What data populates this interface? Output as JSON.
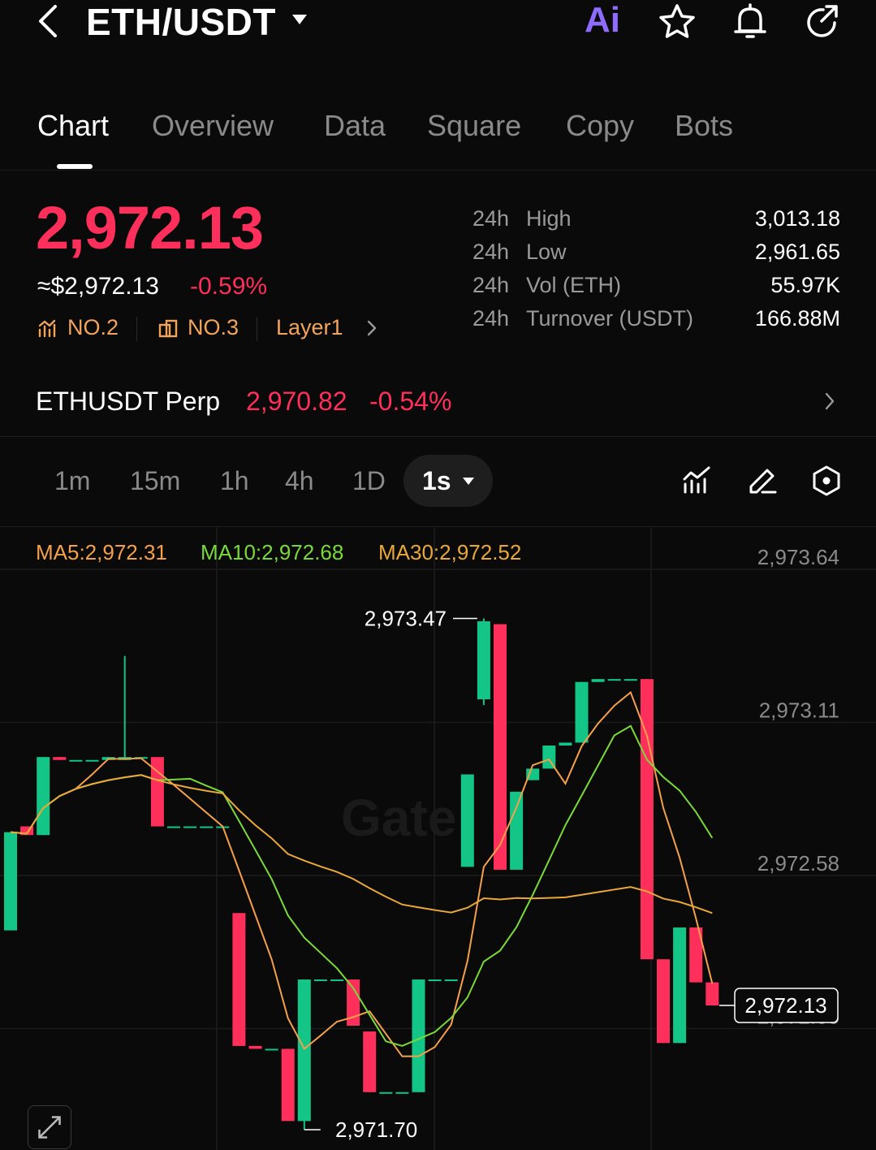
{
  "header": {
    "pair": "ETH/USDT",
    "ai_label": "Ai",
    "icons": [
      "back-icon",
      "caret-down-icon",
      "ai-icon",
      "star-icon",
      "bell-icon",
      "share-icon"
    ]
  },
  "tabs": [
    {
      "label": "Chart",
      "active": true
    },
    {
      "label": "Overview",
      "active": false
    },
    {
      "label": "Data",
      "active": false
    },
    {
      "label": "Square",
      "active": false
    },
    {
      "label": "Copy",
      "active": false
    },
    {
      "label": "Bots",
      "active": false
    }
  ],
  "ticker": {
    "price": "2,972.13",
    "approx": "≈$2,972.13",
    "change": "-0.59%",
    "rank1": "NO.2",
    "rank2": "NO.3",
    "category": "Layer1"
  },
  "stats": [
    {
      "period": "24h",
      "label": "High",
      "value": "3,013.18"
    },
    {
      "period": "24h",
      "label": "Low",
      "value": "2,961.65"
    },
    {
      "period": "24h",
      "label": "Vol (ETH)",
      "value": "55.97K"
    },
    {
      "period": "24h",
      "label": "Turnover (USDT)",
      "value": "166.88M"
    }
  ],
  "perp": {
    "name": "ETHUSDT Perp",
    "price": "2,970.82",
    "change": "-0.54%"
  },
  "intervals": [
    "1m",
    "15m",
    "1h",
    "4h",
    "1D"
  ],
  "active_interval": "1s",
  "ma": {
    "ma5": "MA5:2,972.31",
    "ma10": "MA10:2,972.68",
    "ma30": "MA30:2,972.52"
  },
  "colors": {
    "up": "#13c586",
    "down": "#ff2f5b",
    "ma5": "#f5a04a",
    "ma10": "#7ad93a",
    "ma30": "#e9a83a"
  },
  "chart_data": {
    "type": "candlestick",
    "y_ticks": [
      2973.64,
      2973.11,
      2972.58,
      2972.05
    ],
    "y_tick_labels": [
      "2,973.64",
      "2,973.11",
      "2,972.58",
      "2,972.05"
    ],
    "ylim": [
      2971.7,
      2973.64
    ],
    "high_label": "2,973.47",
    "low_label": "2,971.70",
    "current_label": "2,972.13",
    "current_price": 2972.13,
    "candles": [
      {
        "o": 2972.39,
        "c": 2972.73,
        "h": 2972.73,
        "l": 2972.39
      },
      {
        "o": 2972.75,
        "c": 2972.72,
        "h": 2972.75,
        "l": 2972.72
      },
      {
        "o": 2972.72,
        "c": 2972.99,
        "h": 2972.99,
        "l": 2972.72
      },
      {
        "o": 2972.99,
        "c": 2972.98,
        "h": 2972.99,
        "l": 2972.98
      },
      {
        "o": 2972.98,
        "c": 2972.98,
        "h": 2972.98,
        "l": 2972.98
      },
      {
        "o": 2972.98,
        "c": 2972.98,
        "h": 2972.98,
        "l": 2972.98
      },
      {
        "o": 2972.98,
        "c": 2972.99,
        "h": 2972.99,
        "l": 2972.98
      },
      {
        "o": 2972.98,
        "c": 2972.99,
        "h": 2973.34,
        "l": 2972.98
      },
      {
        "o": 2972.99,
        "c": 2972.99,
        "h": 2972.99,
        "l": 2972.99
      },
      {
        "o": 2972.99,
        "c": 2972.75,
        "h": 2972.99,
        "l": 2972.75
      },
      {
        "o": 2972.75,
        "c": 2972.75,
        "h": 2972.75,
        "l": 2972.75
      },
      {
        "o": 2972.75,
        "c": 2972.75,
        "h": 2972.75,
        "l": 2972.75
      },
      {
        "o": 2972.75,
        "c": 2972.75,
        "h": 2972.75,
        "l": 2972.75
      },
      {
        "o": 2972.75,
        "c": 2972.75,
        "h": 2972.75,
        "l": 2972.75
      },
      {
        "o": 2972.45,
        "c": 2971.99,
        "h": 2972.45,
        "l": 2971.99
      },
      {
        "o": 2971.99,
        "c": 2971.98,
        "h": 2971.99,
        "l": 2971.98
      },
      {
        "o": 2971.98,
        "c": 2971.98,
        "h": 2971.98,
        "l": 2971.98
      },
      {
        "o": 2971.98,
        "c": 2971.73,
        "h": 2971.98,
        "l": 2971.73
      },
      {
        "o": 2971.73,
        "c": 2972.22,
        "h": 2972.22,
        "l": 2971.7
      },
      {
        "o": 2972.22,
        "c": 2972.22,
        "h": 2972.22,
        "l": 2972.22
      },
      {
        "o": 2972.22,
        "c": 2972.22,
        "h": 2972.22,
        "l": 2972.22
      },
      {
        "o": 2972.22,
        "c": 2972.06,
        "h": 2972.22,
        "l": 2972.06
      },
      {
        "o": 2972.04,
        "c": 2971.83,
        "h": 2972.04,
        "l": 2971.83
      },
      {
        "o": 2971.83,
        "c": 2971.83,
        "h": 2971.83,
        "l": 2971.83
      },
      {
        "o": 2971.83,
        "c": 2971.83,
        "h": 2971.83,
        "l": 2971.83
      },
      {
        "o": 2971.83,
        "c": 2972.22,
        "h": 2972.22,
        "l": 2971.83
      },
      {
        "o": 2972.22,
        "c": 2972.22,
        "h": 2972.22,
        "l": 2972.22
      },
      {
        "o": 2972.22,
        "c": 2972.22,
        "h": 2972.22,
        "l": 2972.22
      },
      {
        "o": 2972.61,
        "c": 2972.93,
        "h": 2972.93,
        "l": 2972.61
      },
      {
        "o": 2973.19,
        "c": 2973.46,
        "h": 2973.47,
        "l": 2973.17
      },
      {
        "o": 2973.45,
        "c": 2972.6,
        "h": 2973.45,
        "l": 2972.6
      },
      {
        "o": 2972.6,
        "c": 2972.87,
        "h": 2972.87,
        "l": 2972.6
      },
      {
        "o": 2972.91,
        "c": 2972.95,
        "h": 2972.95,
        "l": 2972.91
      },
      {
        "o": 2972.95,
        "c": 2973.03,
        "h": 2973.03,
        "l": 2972.95
      },
      {
        "o": 2973.03,
        "c": 2973.04,
        "h": 2973.04,
        "l": 2973.03
      },
      {
        "o": 2973.04,
        "c": 2973.25,
        "h": 2973.25,
        "l": 2973.04
      },
      {
        "o": 2973.25,
        "c": 2973.26,
        "h": 2973.26,
        "l": 2973.25
      },
      {
        "o": 2973.26,
        "c": 2973.26,
        "h": 2973.26,
        "l": 2973.26
      },
      {
        "o": 2973.26,
        "c": 2973.26,
        "h": 2973.26,
        "l": 2973.26
      },
      {
        "o": 2973.26,
        "c": 2972.29,
        "h": 2973.26,
        "l": 2972.29
      },
      {
        "o": 2972.29,
        "c": 2972.0,
        "h": 2972.0,
        "l": 2972.29
      },
      {
        "o": 2972.0,
        "c": 2972.4,
        "h": 2972.4,
        "l": 2972.0
      },
      {
        "o": 2972.4,
        "c": 2972.21,
        "h": 2972.4,
        "l": 2972.21
      },
      {
        "o": 2972.21,
        "c": 2972.13,
        "h": 2972.21,
        "l": 2972.13
      }
    ]
  }
}
